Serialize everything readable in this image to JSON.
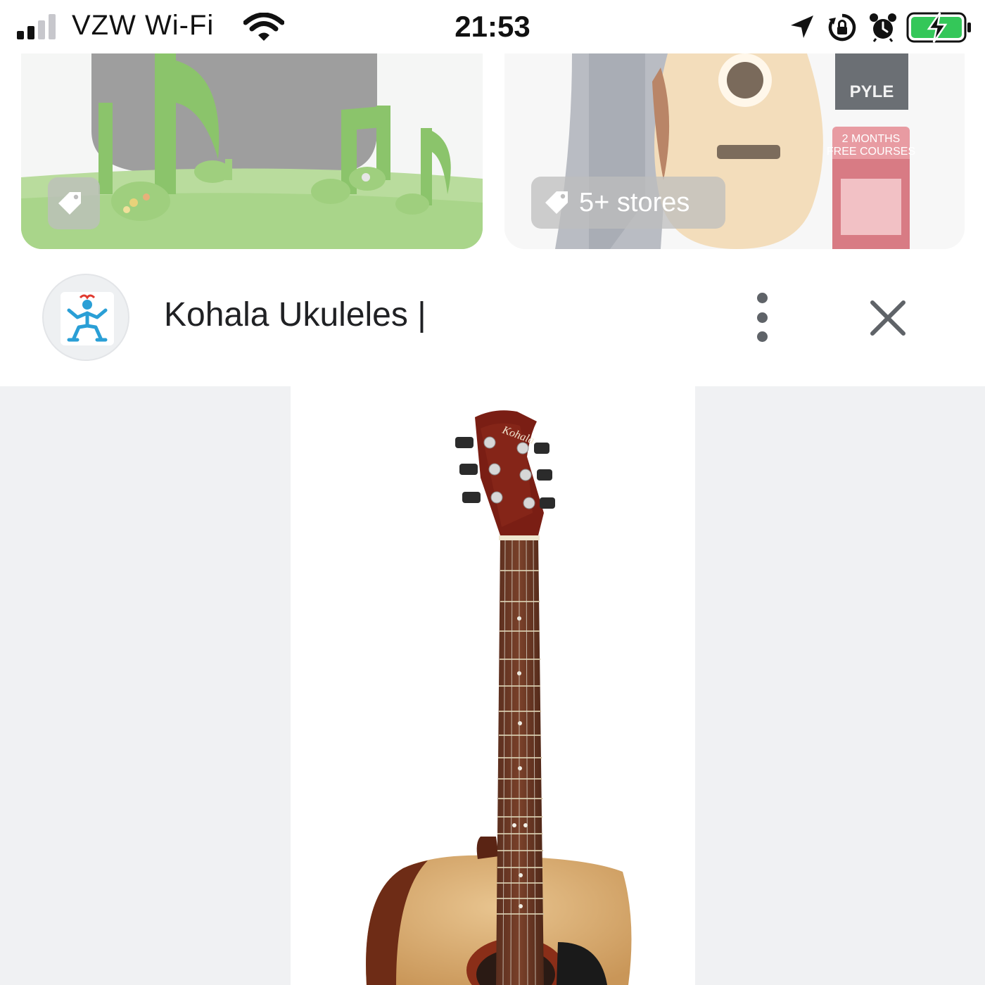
{
  "status_bar": {
    "carrier": "VZW Wi-Fi",
    "time": "21:53",
    "icons": [
      "signal-icon",
      "wifi-icon",
      "location-arrow-icon",
      "orientation-lock-icon",
      "alarm-icon",
      "battery-charging-icon"
    ]
  },
  "results": [
    {
      "badge_icon": "tag-icon",
      "badge_text": ""
    },
    {
      "badge_icon": "tag-icon",
      "badge_text": "5+ stores",
      "brand_text": "PYLE",
      "promo_text": "2 MONTHS FREE COURSES"
    }
  ],
  "source": {
    "title": "Kohala Ukuleles |",
    "logo_icon": "kohala-logo-icon",
    "more_icon": "more-vertical-icon",
    "close_icon": "close-icon"
  },
  "preview": {
    "headstock_text": "Kohala"
  },
  "colors": {
    "accent_green": "#7ed957",
    "preview_bg": "#f0f1f3",
    "icon_gray": "#5f6368",
    "logo_blue": "#2a9fd6"
  }
}
